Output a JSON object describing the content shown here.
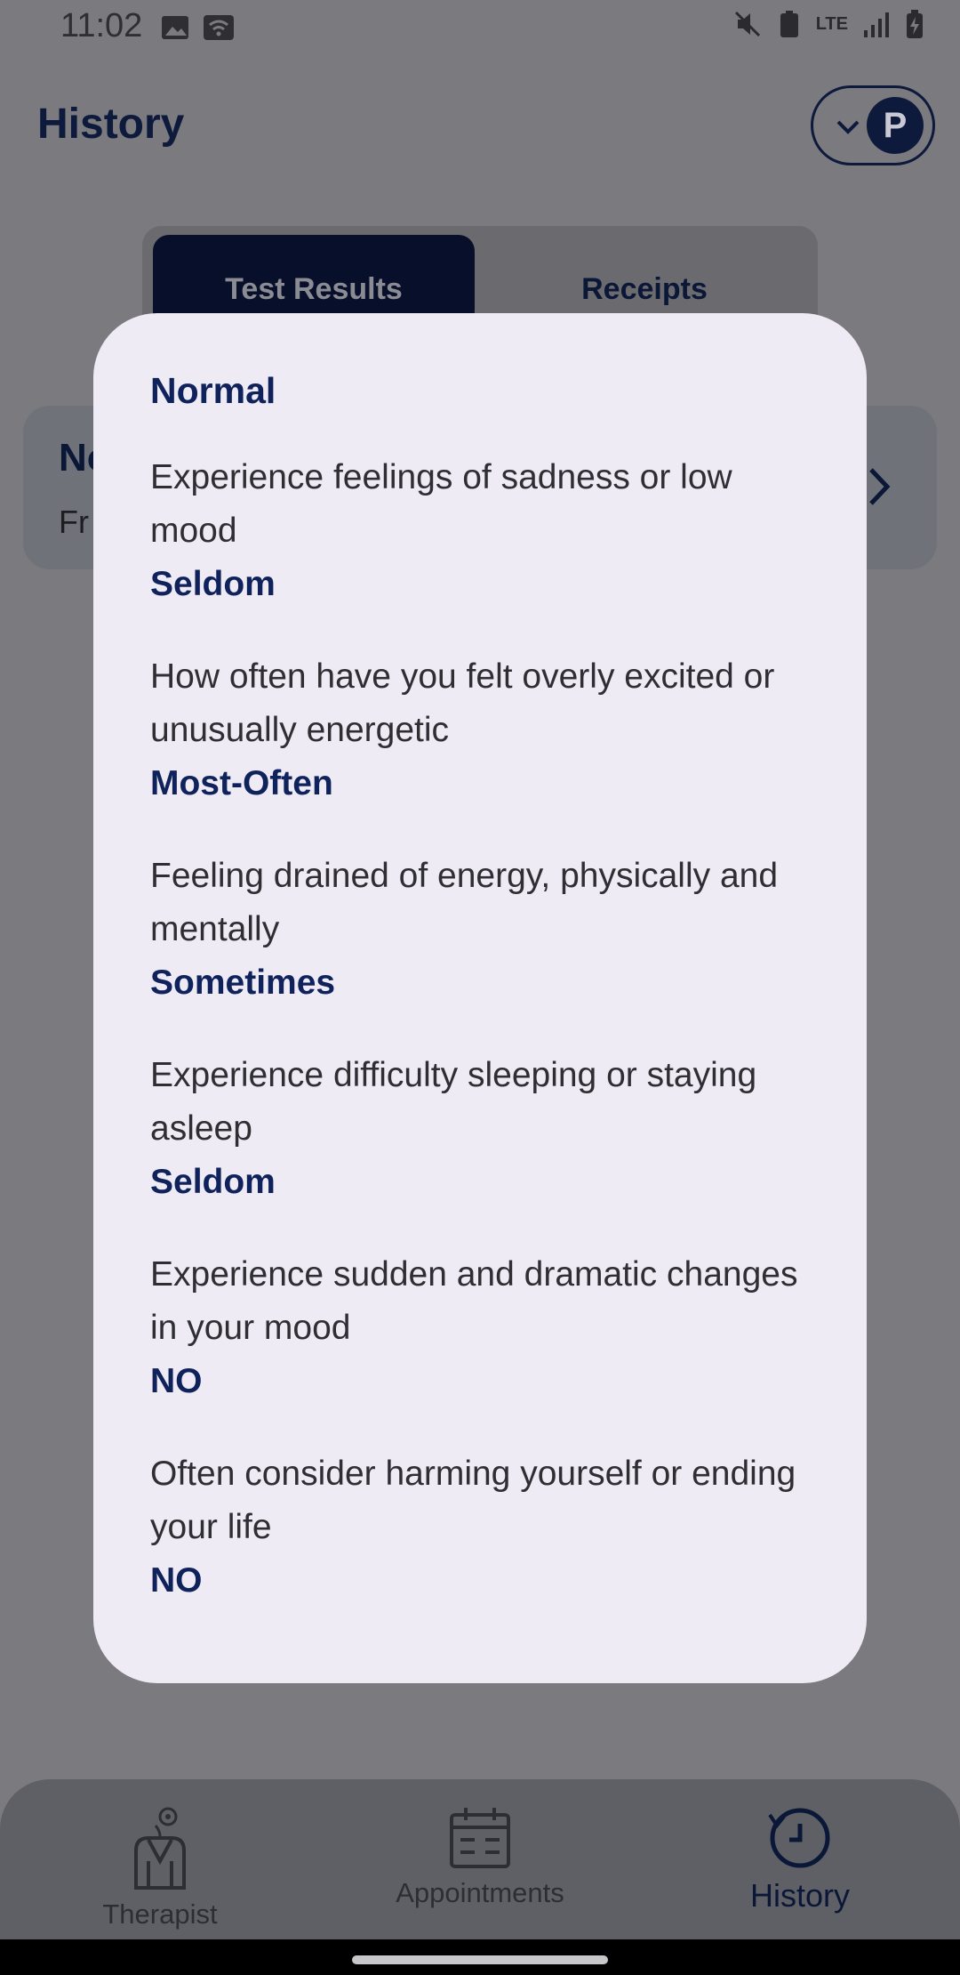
{
  "status_bar": {
    "time": "11:02",
    "network_label": "LTE",
    "icons": [
      "image-icon",
      "wifi-icon",
      "mute-icon",
      "battery-saver-icon",
      "signal-icon",
      "battery-charging-icon"
    ]
  },
  "header": {
    "title": "History",
    "profile_initial": "P"
  },
  "tabs": [
    {
      "label": "Test Results",
      "active": true
    },
    {
      "label": "Receipts",
      "active": false
    }
  ],
  "result_card": {
    "title_partial": "No",
    "subtitle_partial": "Fr"
  },
  "modal": {
    "heading": "Normal",
    "items": [
      {
        "question": "Experience feelings of sadness or low mood",
        "answer": "Seldom"
      },
      {
        "question": "How often have you felt overly excited or unusually energetic",
        "answer": "Most-Often"
      },
      {
        "question": "Feeling drained of energy, physically and mentally",
        "answer": "Sometimes"
      },
      {
        "question": "Experience difficulty sleeping or staying asleep",
        "answer": "Seldom"
      },
      {
        "question": "Experience sudden and dramatic changes in your mood",
        "answer": "NO"
      },
      {
        "question": "Often consider harming yourself or ending your life",
        "answer": "NO"
      }
    ]
  },
  "bottom_nav": [
    {
      "label": "Therapist",
      "icon": "therapist-icon",
      "active": false
    },
    {
      "label": "Appointments",
      "icon": "calendar-icon",
      "active": false
    },
    {
      "label": "History",
      "icon": "history-clock-icon",
      "active": true
    }
  ],
  "colors": {
    "primary_navy": "#10225c",
    "modal_background": "#eeebf4",
    "scrim": "#7b7a7e"
  }
}
